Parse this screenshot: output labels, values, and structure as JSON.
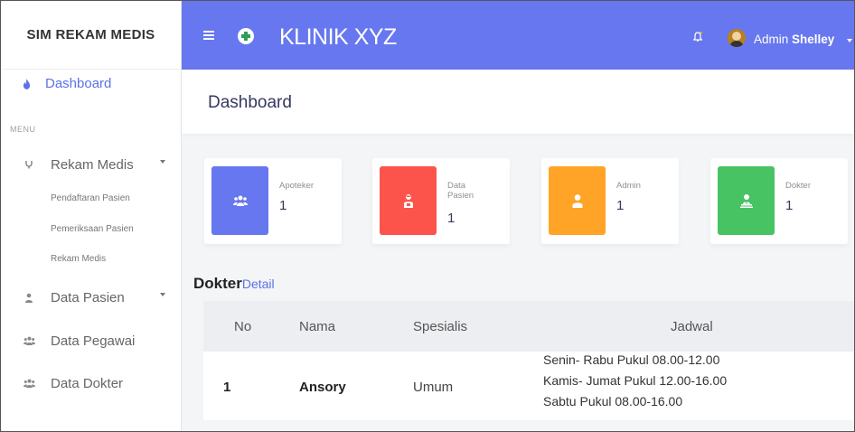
{
  "sidebar": {
    "brand": "SIM REKAM MEDIS",
    "active_item": {
      "label": "Dashboard",
      "icon": "fire-icon"
    },
    "menu_caption": "MENU",
    "items": [
      {
        "label": "Rekam Medis",
        "icon": "stethoscope-icon",
        "has_caret": true,
        "sub": [
          "Pendaftaran Pasien",
          "Pemeriksaan Pasien",
          "Rekam Medis"
        ]
      },
      {
        "label": "Data Pasien",
        "icon": "user-icon",
        "has_caret": true
      },
      {
        "label": "Data Pegawai",
        "icon": "users-icon",
        "has_caret": false
      },
      {
        "label": "Data Dokter",
        "icon": "users-icon",
        "has_caret": false
      }
    ]
  },
  "topbar": {
    "title": "KLINIK XYZ",
    "user_prefix": "Admin",
    "user_name": "Shelley",
    "bg_color": "#6777ef"
  },
  "page": {
    "title": "Dashboard"
  },
  "cards": [
    {
      "label": "Apoteker",
      "value": "1",
      "color": "#6777ef",
      "icon": "users-icon"
    },
    {
      "label": "Data\nPasien",
      "value": "1",
      "color": "#fc544b",
      "icon": "user-injured-icon"
    },
    {
      "label": "Admin",
      "value": "1",
      "color": "#ffa426",
      "icon": "user-icon"
    },
    {
      "label": "Dokter",
      "value": "1",
      "color": "#47c363",
      "icon": "user-md-icon"
    }
  ],
  "dokter": {
    "title": "Dokter",
    "link": "Detail",
    "columns": [
      "No",
      "Nama",
      "Spesialis",
      "Jadwal"
    ],
    "rows": [
      {
        "no": "1",
        "nama": "Ansory",
        "spesialis": "Umum",
        "jadwal": [
          "Senin- Rabu Pukul 08.00-12.00",
          "Kamis- Jumat Pukul 12.00-16.00",
          "Sabtu Pukul 08.00-16.00"
        ]
      }
    ]
  }
}
